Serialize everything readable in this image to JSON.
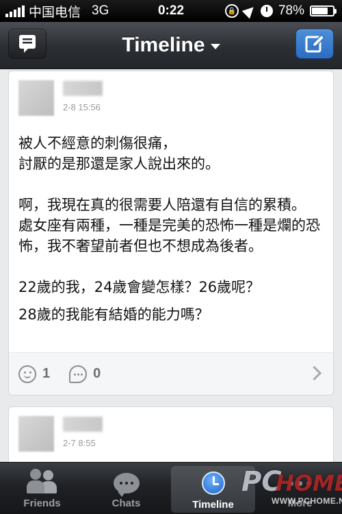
{
  "status_bar": {
    "carrier": "中国电信",
    "network": "3G",
    "time": "0:22",
    "battery_percent": "78%",
    "battery_level": 0.78
  },
  "nav": {
    "title": "Timeline"
  },
  "posts": [
    {
      "time": "2-8 15:56",
      "lines": [
        "被人不經意的刺傷很痛，",
        "討厭的是那還是家人說出來的。",
        "",
        "啊，我現在真的很需要人陪還有自信的累積。",
        "處女座有兩種，一種是完美的恐怖一種是爛的恐怖，我不奢望前者但也不想成為後者。",
        "",
        "22歲的我，24歲會變怎樣？26歲呢？",
        "28歲的我能有結婚的能力嗎？"
      ],
      "likes": "1",
      "comments": "0"
    },
    {
      "time": "2-7 8:55"
    }
  ],
  "tabs": [
    {
      "label": "Friends",
      "icon": "friends-icon"
    },
    {
      "label": "Chats",
      "icon": "chats-icon"
    },
    {
      "label": "Timeline",
      "icon": "timeline-icon",
      "active": true
    },
    {
      "label": "More",
      "icon": "more-icon"
    }
  ],
  "watermark": {
    "brand_pc": "PC",
    "brand_home": "HOME",
    "url": "WWW.PCHOME.NET"
  },
  "colors": {
    "accent_blue": "#2a6cc2",
    "nav_dark": "#2b2e33",
    "background": "#e9eaeb"
  }
}
